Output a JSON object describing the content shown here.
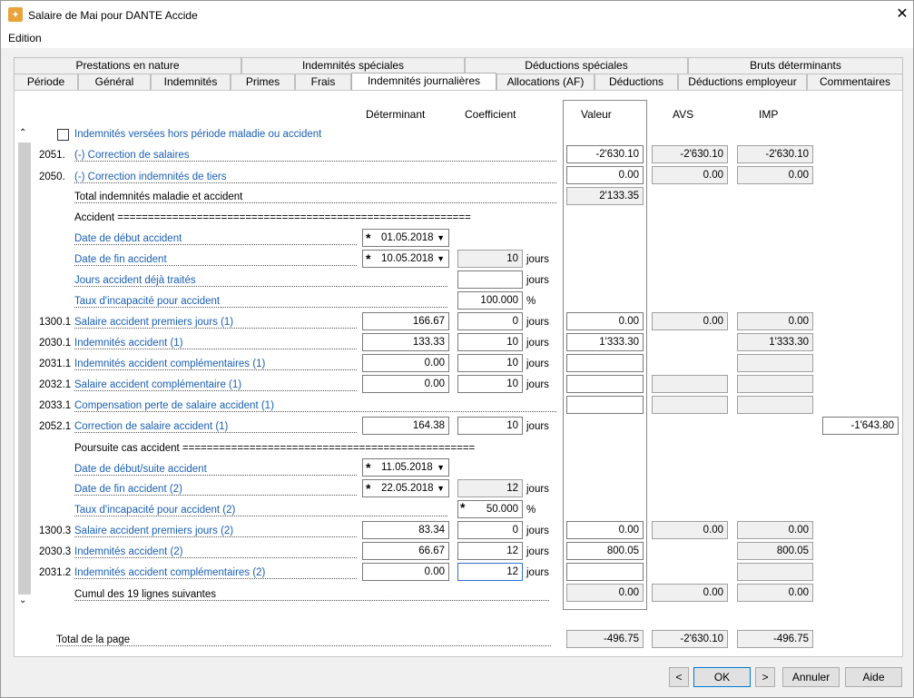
{
  "window": {
    "title": "Salaire de Mai pour DANTE Accide"
  },
  "menu": {
    "edition": "Edition"
  },
  "tabs_top": [
    "Prestations en nature",
    "Indemnités spéciales",
    "Déductions spéciales",
    "Bruts déterminants"
  ],
  "tabs_bottom": [
    "Période",
    "Général",
    "Indemnités",
    "Primes",
    "Frais",
    "Indemnités journalières",
    "Allocations (AF)",
    "Déductions",
    "Déductions employeur",
    "Commentaires"
  ],
  "columns": {
    "determinant": "Déterminant",
    "coefficient": "Coefficient",
    "valeur": "Valeur",
    "avs": "AVS",
    "imp": "IMP"
  },
  "checkbox_label": "Indemnités versées hors période maladie ou accident",
  "rows": {
    "r2051": {
      "code": "2051.",
      "label": "(-) Correction de salaires",
      "valeur": "-2'630.10",
      "avs": "-2'630.10",
      "imp": "-2'630.10"
    },
    "r2050": {
      "code": "2050.",
      "label": "(-) Correction indemnités de tiers",
      "valeur": "0.00",
      "avs": "0.00",
      "imp": "0.00"
    },
    "total_maladie": {
      "label": "Total indemnités maladie et accident",
      "valeur": "2'133.35"
    },
    "accident_header": "Accident ==========================================================",
    "date_debut": {
      "label": "Date de début accident",
      "value": "01.05.2018"
    },
    "date_fin": {
      "label": "Date de fin accident",
      "value": "10.05.2018",
      "coef": "10",
      "unit": "jours"
    },
    "jours_traites": {
      "label": "Jours accident déjà traités",
      "coef": "",
      "unit": "jours"
    },
    "taux": {
      "label": "Taux d'incapacité pour accident",
      "coef": "100.000",
      "unit": "%"
    },
    "r1300_1": {
      "code": "1300.1",
      "label": "Salaire accident premiers jours (1)",
      "det": "166.67",
      "coef": "0",
      "unit": "jours",
      "valeur": "0.00",
      "avs": "0.00",
      "imp": "0.00"
    },
    "r2030_1": {
      "code": "2030.1",
      "label": "Indemnités accident (1)",
      "det": "133.33",
      "coef": "10",
      "unit": "jours",
      "valeur": "1'333.30",
      "imp": "1'333.30"
    },
    "r2031_1": {
      "code": "2031.1",
      "label": "Indemnités accident complémentaires (1)",
      "det": "0.00",
      "coef": "10",
      "unit": "jours"
    },
    "r2032_1": {
      "code": "2032.1",
      "label": "Salaire accident complémentaire (1)",
      "det": "0.00",
      "coef": "10",
      "unit": "jours"
    },
    "r2033_1": {
      "code": "2033.1",
      "label": "Compensation perte de salaire accident (1)"
    },
    "r2052_1": {
      "code": "2052.1",
      "label": "Correction de salaire accident (1)",
      "det": "164.38",
      "coef": "10",
      "unit": "jours",
      "extra": "-1'643.80"
    },
    "poursuite_header": "Poursuite cas accident ================================================",
    "date_debut2": {
      "label": "Date de début/suite accident",
      "value": "11.05.2018"
    },
    "date_fin2": {
      "label": "Date de fin accident (2)",
      "value": "22.05.2018",
      "coef": "12",
      "unit": "jours"
    },
    "taux2": {
      "label": "Taux d'incapacité pour accident (2)",
      "coef": "50.000",
      "unit": "%"
    },
    "r1300_3": {
      "code": "1300.3",
      "label": "Salaire accident premiers jours (2)",
      "det": "83.34",
      "coef": "0",
      "unit": "jours",
      "valeur": "0.00",
      "avs": "0.00",
      "imp": "0.00"
    },
    "r2030_3": {
      "code": "2030.3",
      "label": "Indemnités accident (2)",
      "det": "66.67",
      "coef": "12",
      "unit": "jours",
      "valeur": "800.05",
      "imp": "800.05"
    },
    "r2031_2": {
      "code": "2031.2",
      "label": "Indemnités accident complémentaires (2)",
      "det": "0.00",
      "coef": "12",
      "unit": "jours"
    },
    "cumul": {
      "label": "Cumul des 19 lignes suivantes",
      "valeur": "0.00",
      "avs": "0.00",
      "imp": "0.00"
    }
  },
  "total_page": {
    "label": "Total de la page",
    "valeur": "-496.75",
    "avs": "-2'630.10",
    "imp": "-496.75"
  },
  "buttons": {
    "prev": "<",
    "ok": "OK",
    "next": ">",
    "cancel": "Annuler",
    "help": "Aide"
  }
}
